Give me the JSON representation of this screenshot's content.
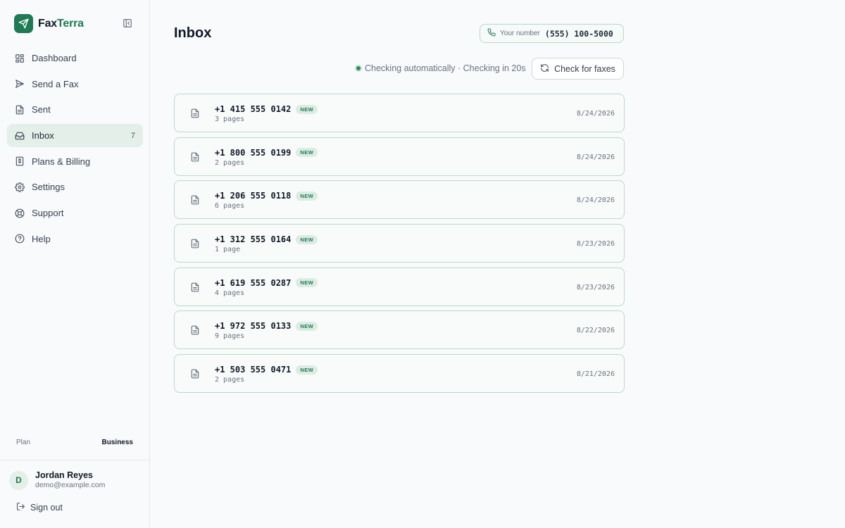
{
  "brand": {
    "name_part1": "Fax",
    "name_part2": "Terra"
  },
  "sidebar": {
    "items": [
      {
        "label": "Dashboard",
        "icon": "grid-icon"
      },
      {
        "label": "Send a Fax",
        "icon": "send-icon"
      },
      {
        "label": "Sent",
        "icon": "file-icon"
      },
      {
        "label": "Inbox",
        "icon": "inbox-icon",
        "count": "7",
        "active": true
      },
      {
        "label": "Plans & Billing",
        "icon": "dollar-icon"
      },
      {
        "label": "Settings",
        "icon": "gear-icon"
      },
      {
        "label": "Support",
        "icon": "lifebuoy-icon"
      },
      {
        "label": "Help",
        "icon": "help-circle-icon"
      }
    ],
    "plan": {
      "label": "Plan",
      "value": "Business"
    },
    "user": {
      "initial": "D",
      "name": "Jordan Reyes",
      "email": "demo@example.com"
    },
    "signout_label": "Sign out"
  },
  "main": {
    "title": "Inbox",
    "your_number": {
      "label": "Your number",
      "value": "(555) 100-5000"
    },
    "status_text": "Checking automatically · Checking in 20s",
    "check_button_label": "Check for faxes",
    "faxes": [
      {
        "from": "+1 415 555 0142",
        "badge": "NEW",
        "pages": "3 pages",
        "date": "8/24/2026"
      },
      {
        "from": "+1 800 555 0199",
        "badge": "NEW",
        "pages": "2 pages",
        "date": "8/24/2026"
      },
      {
        "from": "+1 206 555 0118",
        "badge": "NEW",
        "pages": "6 pages",
        "date": "8/24/2026"
      },
      {
        "from": "+1 312 555 0164",
        "badge": "NEW",
        "pages": "1 page",
        "date": "8/23/2026"
      },
      {
        "from": "+1 619 555 0287",
        "badge": "NEW",
        "pages": "4 pages",
        "date": "8/23/2026"
      },
      {
        "from": "+1 972 555 0133",
        "badge": "NEW",
        "pages": "9 pages",
        "date": "8/22/2026"
      },
      {
        "from": "+1 503 555 0471",
        "badge": "NEW",
        "pages": "2 pages",
        "date": "8/21/2026"
      }
    ]
  },
  "colors": {
    "accent": "#1f7a55",
    "active_bg": "#e3efe8",
    "row_border": "#bcdac9"
  }
}
